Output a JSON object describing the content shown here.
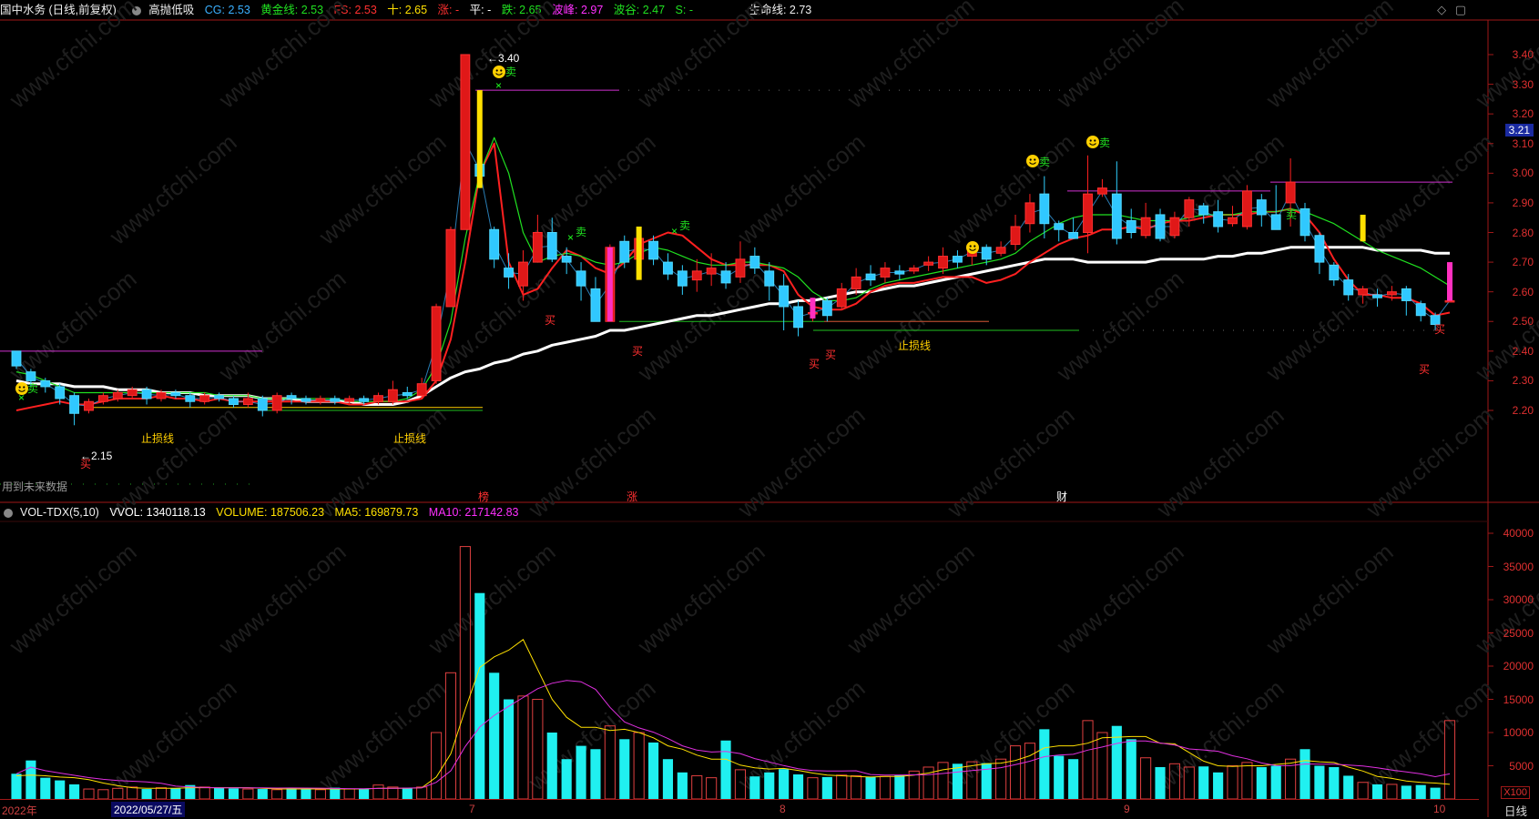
{
  "header": {
    "stock": "国中水务 (日线,前复权)",
    "indicator": "高抛低吸",
    "items": [
      {
        "label": "CG: 2.53",
        "color": "#3ab0ff"
      },
      {
        "label": "黄金线: 2.53",
        "color": "#20e020"
      },
      {
        "label": "FS: 2.53",
        "color": "#ff3030"
      },
      {
        "label": "十: 2.65",
        "color": "#ffe000"
      },
      {
        "label": "涨: -",
        "color": "#ff3030"
      },
      {
        "label": "平: -",
        "color": "#ffffff"
      },
      {
        "label": "跌: 2.65",
        "color": "#20e020"
      },
      {
        "label": "波峰: 2.97",
        "color": "#ff30ff"
      },
      {
        "label": "波谷: 2.47",
        "color": "#20e020"
      },
      {
        "label": "S: -",
        "color": "#20e020"
      }
    ],
    "lifeline": "生命线: 2.73"
  },
  "price_axis": {
    "ticks": [
      "3.40",
      "3.30",
      "3.20",
      "3.10",
      "3.00",
      "2.90",
      "2.80",
      "2.70",
      "2.60",
      "2.50",
      "2.40",
      "2.30",
      "2.20"
    ],
    "current_price": "3.21"
  },
  "volume_header": {
    "name": "VOL-TDX(5,10)",
    "vvol": "VVOL: 1340118.13",
    "volume": "VOLUME: 187506.23",
    "ma5": "MA5: 169879.73",
    "ma10": "MA10: 217142.83",
    "colors": {
      "vvol": "#ffffff",
      "volume": "#ffe000",
      "ma5": "#ffe000",
      "ma10": "#ff30ff"
    }
  },
  "volume_axis": {
    "ticks": [
      "40000",
      "35000",
      "30000",
      "25000",
      "20000",
      "15000",
      "10000",
      "5000"
    ],
    "unit": "X100"
  },
  "chart_labels": {
    "high": "3.40",
    "low": "2.15",
    "stoploss": "止损线",
    "future_note": "用到未来数据",
    "buy": "买",
    "sell": "卖",
    "markers": [
      "榜",
      "涨",
      "财"
    ]
  },
  "time_axis": {
    "labels": [
      "2022年",
      "7",
      "8",
      "9",
      "10"
    ],
    "selected_date": "2022/05/27/五",
    "period": "日线"
  },
  "chart_data": [
    {
      "type": "candlestick",
      "title": "国中水务 (日线,前复权)",
      "ylim": [
        2.1,
        3.46
      ],
      "candles": [
        [
          2.4,
          2.35,
          2.4,
          2.34
        ],
        [
          2.33,
          2.3,
          2.34,
          2.28
        ],
        [
          2.3,
          2.28,
          2.31,
          2.26
        ],
        [
          2.28,
          2.24,
          2.29,
          2.22
        ],
        [
          2.25,
          2.19,
          2.26,
          2.15
        ],
        [
          2.2,
          2.23,
          2.24,
          2.19
        ],
        [
          2.23,
          2.25,
          2.26,
          2.22
        ],
        [
          2.24,
          2.26,
          2.27,
          2.23
        ],
        [
          2.25,
          2.27,
          2.28,
          2.24
        ],
        [
          2.27,
          2.24,
          2.28,
          2.22
        ],
        [
          2.24,
          2.26,
          2.27,
          2.23
        ],
        [
          2.26,
          2.25,
          2.27,
          2.24
        ],
        [
          2.25,
          2.23,
          2.26,
          2.21
        ],
        [
          2.23,
          2.25,
          2.26,
          2.22
        ],
        [
          2.25,
          2.24,
          2.26,
          2.23
        ],
        [
          2.24,
          2.22,
          2.25,
          2.21
        ],
        [
          2.22,
          2.24,
          2.26,
          2.21
        ],
        [
          2.24,
          2.2,
          2.25,
          2.18
        ],
        [
          2.2,
          2.25,
          2.26,
          2.19
        ],
        [
          2.25,
          2.24,
          2.26,
          2.22
        ],
        [
          2.24,
          2.23,
          2.25,
          2.22
        ],
        [
          2.23,
          2.24,
          2.25,
          2.22
        ],
        [
          2.24,
          2.23,
          2.25,
          2.22
        ],
        [
          2.23,
          2.24,
          2.25,
          2.22
        ],
        [
          2.24,
          2.23,
          2.25,
          2.22
        ],
        [
          2.23,
          2.25,
          2.26,
          2.22
        ],
        [
          2.23,
          2.27,
          2.3,
          2.22
        ],
        [
          2.26,
          2.25,
          2.28,
          2.24
        ],
        [
          2.25,
          2.29,
          2.31,
          2.24
        ],
        [
          2.3,
          2.55,
          2.56,
          2.29
        ],
        [
          2.55,
          2.81,
          2.82,
          2.55
        ],
        [
          2.81,
          3.4,
          3.4,
          2.98
        ],
        [
          3.03,
          2.99,
          3.11,
          2.95
        ],
        [
          2.81,
          2.71,
          2.82,
          2.68
        ],
        [
          2.68,
          2.65,
          2.73,
          2.61
        ],
        [
          2.62,
          2.7,
          2.74,
          2.57
        ],
        [
          2.7,
          2.8,
          2.86,
          2.7
        ],
        [
          2.8,
          2.71,
          2.85,
          2.7
        ],
        [
          2.72,
          2.7,
          2.75,
          2.66
        ],
        [
          2.67,
          2.62,
          2.7,
          2.57
        ],
        [
          2.61,
          2.5,
          2.65,
          2.5
        ],
        [
          2.5,
          2.75,
          2.76,
          2.5
        ],
        [
          2.77,
          2.7,
          2.79,
          2.68
        ],
        [
          2.71,
          2.78,
          2.8,
          2.7
        ],
        [
          2.77,
          2.71,
          2.79,
          2.69
        ],
        [
          2.7,
          2.66,
          2.73,
          2.64
        ],
        [
          2.67,
          2.62,
          2.69,
          2.59
        ],
        [
          2.64,
          2.67,
          2.71,
          2.6
        ],
        [
          2.66,
          2.68,
          2.73,
          2.62
        ],
        [
          2.67,
          2.63,
          2.7,
          2.61
        ],
        [
          2.65,
          2.71,
          2.77,
          2.63
        ],
        [
          2.72,
          2.68,
          2.75,
          2.66
        ],
        [
          2.67,
          2.62,
          2.7,
          2.57
        ],
        [
          2.62,
          2.55,
          2.66,
          2.47
        ],
        [
          2.55,
          2.48,
          2.57,
          2.45
        ],
        [
          2.53,
          2.53,
          2.58,
          2.5
        ],
        [
          2.57,
          2.52,
          2.58,
          2.5
        ],
        [
          2.55,
          2.61,
          2.63,
          2.54
        ],
        [
          2.61,
          2.65,
          2.68,
          2.59
        ],
        [
          2.66,
          2.64,
          2.69,
          2.62
        ],
        [
          2.65,
          2.68,
          2.7,
          2.63
        ],
        [
          2.67,
          2.66,
          2.69,
          2.64
        ],
        [
          2.67,
          2.68,
          2.69,
          2.66
        ],
        [
          2.69,
          2.7,
          2.72,
          2.67
        ],
        [
          2.68,
          2.72,
          2.75,
          2.66
        ],
        [
          2.72,
          2.7,
          2.74,
          2.68
        ],
        [
          2.72,
          2.75,
          2.77,
          2.69
        ],
        [
          2.75,
          2.71,
          2.76,
          2.69
        ],
        [
          2.73,
          2.75,
          2.77,
          2.72
        ],
        [
          2.76,
          2.82,
          2.86,
          2.74
        ],
        [
          2.83,
          2.9,
          2.93,
          2.8
        ],
        [
          2.93,
          2.83,
          2.99,
          2.78
        ],
        [
          2.83,
          2.81,
          2.84,
          2.77
        ],
        [
          2.8,
          2.78,
          2.85,
          2.78
        ],
        [
          2.8,
          2.93,
          3.06,
          2.73
        ],
        [
          2.93,
          2.95,
          2.98,
          2.92
        ],
        [
          2.93,
          2.78,
          3.04,
          2.76
        ],
        [
          2.84,
          2.8,
          2.88,
          2.78
        ],
        [
          2.79,
          2.85,
          2.9,
          2.78
        ],
        [
          2.86,
          2.78,
          2.88,
          2.77
        ],
        [
          2.79,
          2.85,
          2.87,
          2.78
        ],
        [
          2.85,
          2.91,
          2.92,
          2.82
        ],
        [
          2.89,
          2.86,
          2.9,
          2.83
        ],
        [
          2.87,
          2.82,
          2.91,
          2.8
        ],
        [
          2.83,
          2.85,
          2.89,
          2.82
        ],
        [
          2.82,
          2.94,
          2.96,
          2.81
        ],
        [
          2.91,
          2.86,
          2.93,
          2.82
        ],
        [
          2.86,
          2.81,
          2.96,
          2.84
        ],
        [
          2.9,
          2.97,
          3.05,
          2.82
        ],
        [
          2.88,
          2.79,
          2.9,
          2.77
        ],
        [
          2.79,
          2.7,
          2.8,
          2.66
        ],
        [
          2.69,
          2.64,
          2.7,
          2.62
        ],
        [
          2.64,
          2.59,
          2.66,
          2.57
        ],
        [
          2.59,
          2.61,
          2.62,
          2.56
        ],
        [
          2.59,
          2.58,
          2.61,
          2.55
        ],
        [
          2.59,
          2.6,
          2.62,
          2.57
        ],
        [
          2.61,
          2.57,
          2.62,
          2.52
        ],
        [
          2.56,
          2.52,
          2.57,
          2.5
        ],
        [
          2.52,
          2.49,
          2.53,
          2.47
        ],
        [
          2.57,
          2.57,
          2.7,
          2.57
        ]
      ],
      "series": [
        {
          "name": "生命线",
          "color": "#ffffff",
          "values": [
            2.3,
            2.29,
            2.29,
            2.29,
            2.28,
            2.28,
            2.28,
            2.27,
            2.27,
            2.27,
            2.26,
            2.26,
            2.26,
            2.25,
            2.25,
            2.25,
            2.25,
            2.24,
            2.24,
            2.24,
            2.23,
            2.23,
            2.23,
            2.23,
            2.22,
            2.22,
            2.22,
            2.23,
            2.25,
            2.28,
            2.31,
            2.33,
            2.34,
            2.36,
            2.37,
            2.39,
            2.4,
            2.42,
            2.43,
            2.44,
            2.45,
            2.47,
            2.47,
            2.48,
            2.49,
            2.5,
            2.51,
            2.52,
            2.52,
            2.53,
            2.54,
            2.55,
            2.56,
            2.56,
            2.57,
            2.57,
            2.58,
            2.59,
            2.6,
            2.6,
            2.61,
            2.62,
            2.62,
            2.63,
            2.64,
            2.65,
            2.66,
            2.67,
            2.68,
            2.69,
            2.7,
            2.71,
            2.71,
            2.71,
            2.7,
            2.7,
            2.7,
            2.7,
            2.7,
            2.71,
            2.71,
            2.71,
            2.71,
            2.72,
            2.72,
            2.73,
            2.73,
            2.74,
            2.75,
            2.75,
            2.75,
            2.75,
            2.75,
            2.75,
            2.74,
            2.74,
            2.74,
            2.74,
            2.73,
            2.73
          ]
        },
        {
          "name": "FS",
          "color": "#ff2020",
          "values": [
            2.2,
            2.21,
            2.22,
            2.23,
            2.22,
            2.22,
            2.23,
            2.24,
            2.24,
            2.24,
            2.25,
            2.24,
            2.24,
            2.23,
            2.24,
            2.23,
            2.23,
            2.23,
            2.23,
            2.23,
            2.23,
            2.23,
            2.23,
            2.22,
            2.22,
            2.23,
            2.23,
            2.23,
            2.24,
            2.3,
            2.44,
            2.7,
            3.0,
            3.1,
            2.7,
            2.59,
            2.61,
            2.68,
            2.74,
            2.72,
            2.68,
            2.66,
            2.7,
            2.76,
            2.78,
            2.8,
            2.79,
            2.75,
            2.71,
            2.69,
            2.69,
            2.69,
            2.69,
            2.67,
            2.59,
            2.55,
            2.54,
            2.54,
            2.56,
            2.6,
            2.62,
            2.63,
            2.63,
            2.64,
            2.65,
            2.65,
            2.65,
            2.63,
            2.64,
            2.66,
            2.7,
            2.73,
            2.76,
            2.78,
            2.79,
            2.81,
            2.81,
            2.82,
            2.81,
            2.83,
            2.84,
            2.84,
            2.85,
            2.86,
            2.86,
            2.86,
            2.87,
            2.87,
            2.88,
            2.86,
            2.8,
            2.71,
            2.64,
            2.59,
            2.59,
            2.58,
            2.58,
            2.56,
            2.52,
            2.53
          ]
        },
        {
          "name": "黄金线",
          "color": "#20e020",
          "values": [
            2.33,
            2.32,
            2.3,
            2.28,
            2.26,
            2.26,
            2.26,
            2.26,
            2.26,
            2.26,
            2.26,
            2.26,
            2.26,
            2.26,
            2.25,
            2.25,
            2.25,
            2.24,
            2.24,
            2.24,
            2.24,
            2.24,
            2.24,
            2.23,
            2.23,
            2.23,
            2.23,
            2.24,
            2.27,
            2.35,
            2.5,
            2.78,
            3.0,
            3.12,
            3.0,
            2.8,
            2.7,
            2.72,
            2.73,
            2.72,
            2.7,
            2.69,
            2.7,
            2.73,
            2.75,
            2.74,
            2.72,
            2.7,
            2.69,
            2.69,
            2.7,
            2.7,
            2.69,
            2.68,
            2.65,
            2.6,
            2.57,
            2.57,
            2.58,
            2.61,
            2.63,
            2.64,
            2.65,
            2.66,
            2.67,
            2.68,
            2.69,
            2.7,
            2.71,
            2.73,
            2.77,
            2.8,
            2.83,
            2.85,
            2.86,
            2.86,
            2.86,
            2.85,
            2.84,
            2.84,
            2.84,
            2.85,
            2.86,
            2.86,
            2.86,
            2.87,
            2.87,
            2.87,
            2.88,
            2.87,
            2.85,
            2.83,
            2.8,
            2.77,
            2.74,
            2.72,
            2.7,
            2.68,
            2.65,
            2.62
          ]
        }
      ]
    },
    {
      "type": "bar",
      "title": "VOL-TDX(5,10)",
      "ylim": [
        0,
        42000
      ],
      "values": [
        3800,
        5800,
        3200,
        2800,
        2200,
        1500,
        1400,
        1600,
        1800,
        1500,
        1700,
        1600,
        2100,
        1800,
        1700,
        1600,
        1500,
        1500,
        1400,
        1700,
        1600,
        1400,
        1700,
        1500,
        1500,
        2100,
        1800,
        1700,
        1800,
        10000,
        19000,
        38000,
        31000,
        19000,
        15000,
        15500,
        15000,
        10000,
        6000,
        8000,
        7500,
        11000,
        9000,
        10000,
        8500,
        6000,
        4000,
        3500,
        3200,
        8800,
        4400,
        3400,
        4000,
        4500,
        3700,
        3200,
        3300,
        3600,
        3500,
        3300,
        3400,
        3600,
        4200,
        4800,
        5500,
        5300,
        5600,
        5400,
        6000,
        8000,
        8400,
        10500,
        6500,
        6000,
        11800,
        10000,
        11000,
        9000,
        6200,
        4800,
        5300,
        4800,
        4900,
        4000,
        5000,
        5500,
        4800,
        5000,
        6000,
        7500,
        5000,
        4800,
        3500,
        2500,
        2200,
        2200,
        2000,
        2100,
        1700,
        11800
      ],
      "ma5": [
        3500,
        3600,
        3500,
        3300,
        3200,
        2900,
        2400,
        2000,
        1700,
        1600,
        1600,
        1600,
        1700,
        1700,
        1700,
        1700,
        1700,
        1600,
        1500,
        1500,
        1500,
        1500,
        1500,
        1500,
        1500,
        1600,
        1600,
        1600,
        1700,
        3300,
        6800,
        13500,
        19800,
        21400,
        22400,
        24000,
        19500,
        15000,
        12300,
        10800,
        10800,
        10300,
        10500,
        10000,
        9200,
        8000,
        7500,
        6600,
        6000,
        6000,
        5100,
        4700,
        4500,
        4600,
        4300,
        3900,
        3600,
        3500,
        3400,
        3300,
        3400,
        3400,
        3600,
        3900,
        4400,
        4700,
        5000,
        5300,
        5400,
        5800,
        6500,
        7700,
        8000,
        8000,
        8400,
        9200,
        9300,
        9400,
        9400,
        8400,
        8300,
        7000,
        5700,
        5000,
        4900,
        5000,
        5000,
        5200,
        5400,
        5800,
        5600,
        5500,
        4800,
        4200,
        3400,
        3100,
        2700,
        2500,
        2400,
        2200
      ]
    }
  ]
}
